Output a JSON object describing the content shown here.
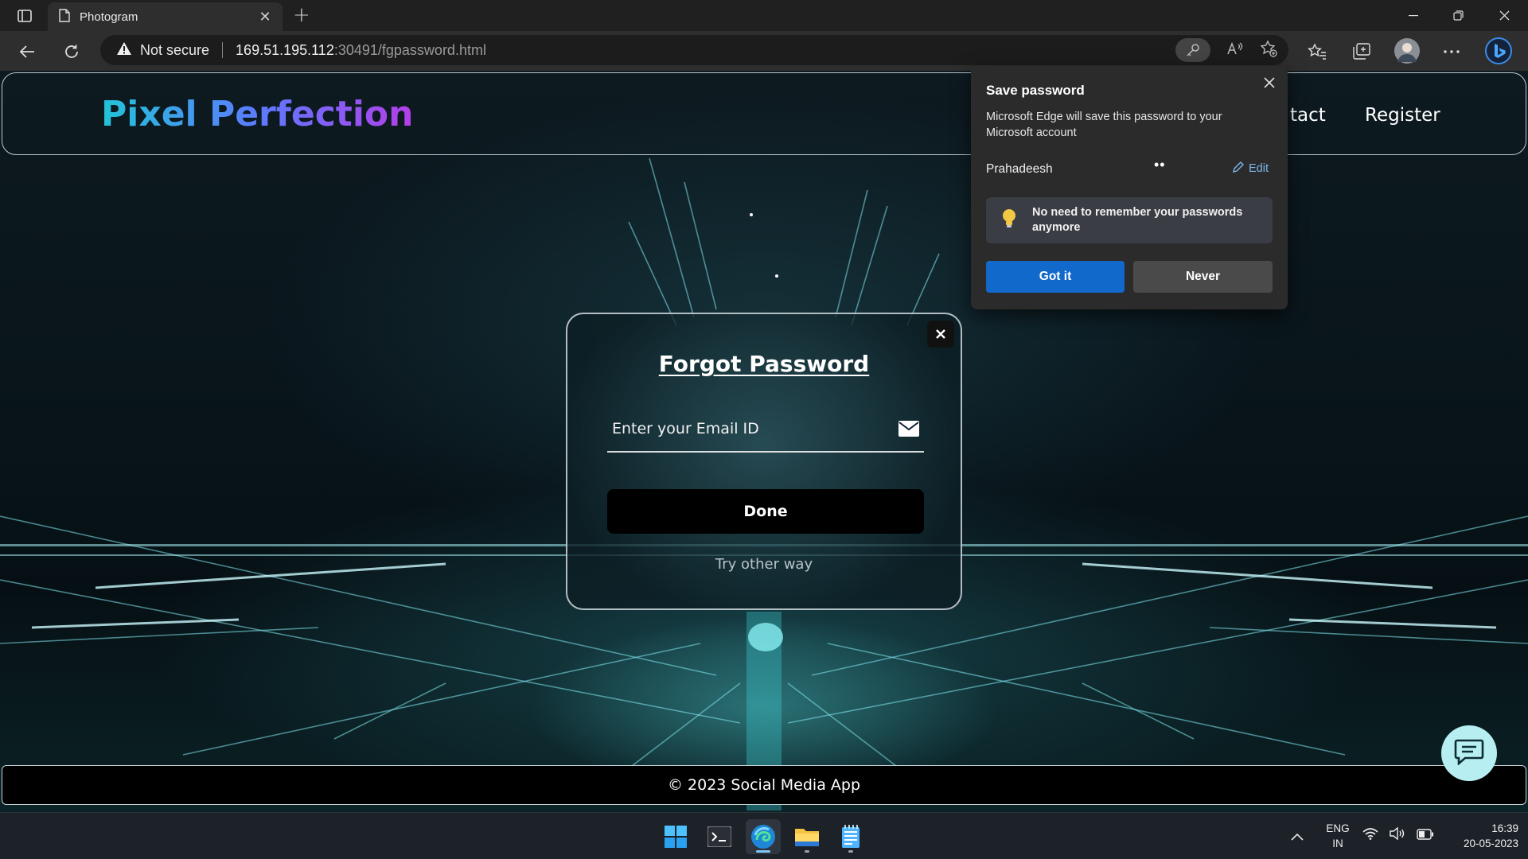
{
  "browser": {
    "tab_title": "Photogram",
    "address": {
      "security_label": "Not secure",
      "host": "169.51.195.112",
      "rest": ":30491/fgpassword.html"
    }
  },
  "site": {
    "brand": "Pixel Perfection",
    "nav": [
      {
        "label": "tact"
      },
      {
        "label": "Register"
      }
    ],
    "footer": "© 2023 Social Media App"
  },
  "forgot_password": {
    "title": "Forgot Password",
    "email_placeholder": "Enter your Email ID",
    "email_value": "",
    "done_label": "Done",
    "alternate_label": "Try other way"
  },
  "save_password_popup": {
    "title": "Save password",
    "description": "Microsoft Edge will save this password to your Microsoft account",
    "username": "Prahadeesh",
    "password_mask": "••",
    "edit_label": "Edit",
    "tip": "No need to remember your passwords anymore",
    "primary_label": "Got it",
    "secondary_label": "Never"
  },
  "taskbar": {
    "language_line1": "ENG",
    "language_line2": "IN",
    "time": "16:39",
    "date": "20-05-2023",
    "apps": [
      "start-icon",
      "terminal-icon",
      "edge-icon",
      "file-explorer-icon",
      "notepad-icon"
    ]
  },
  "colors": {
    "accent_blue": "#1169cc",
    "brand_gradient": [
      "#22c3d8",
      "#5b7bff",
      "#b43ee8"
    ],
    "chat_fab": "#b7eef2"
  }
}
